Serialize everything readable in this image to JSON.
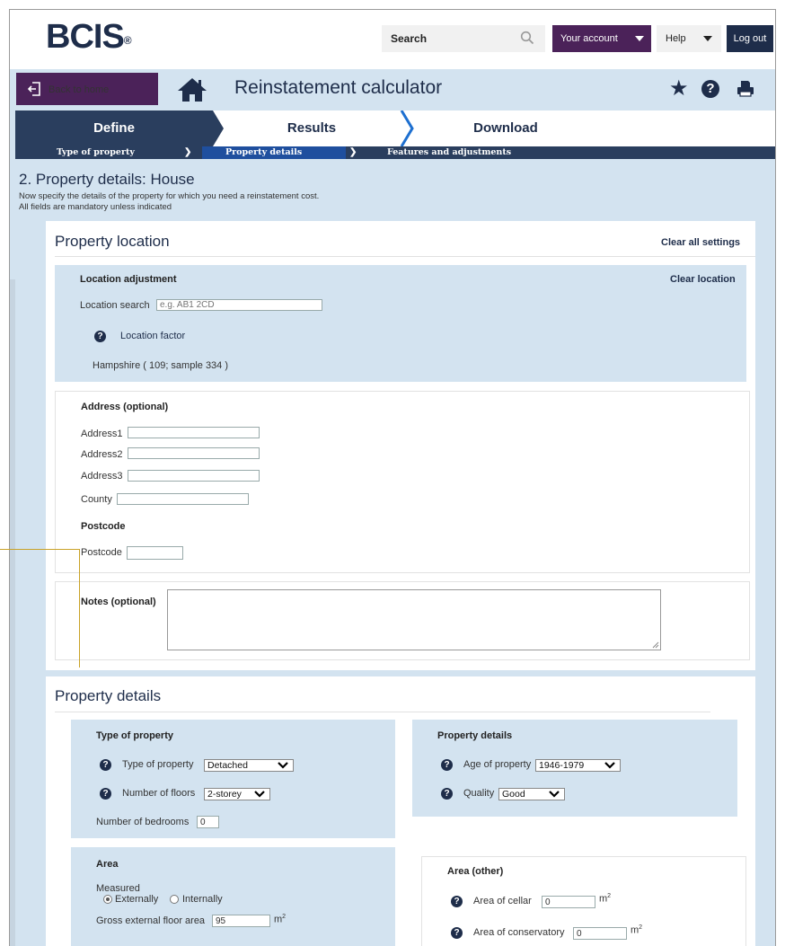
{
  "header": {
    "logo": "BCIS",
    "logo_reg": "®",
    "search_label": "Search",
    "account_label": "Your account",
    "help_label": "Help",
    "logout_label": "Log out"
  },
  "titlebar": {
    "back_label": "Back to home",
    "title": "Reinstatement calculator"
  },
  "steps": [
    {
      "label": "Define"
    },
    {
      "label": "Results"
    },
    {
      "label": "Download"
    }
  ],
  "substeps": [
    {
      "label": "Type of property"
    },
    {
      "label": "Property details"
    },
    {
      "label": "Features and adjustments"
    }
  ],
  "page": {
    "heading": "2. Property details: House",
    "intro1": "Now specify the details of the property for which you need a reinstatement cost.",
    "intro2": "All fields are mandatory unless indicated"
  },
  "location": {
    "title": "Property location",
    "clear_all": "Clear all settings",
    "adj_title": "Location adjustment",
    "clear_location": "Clear location",
    "search_label": "Location search",
    "search_placeholder": "e.g. AB1 2CD",
    "factor_label": "Location factor",
    "factor_value": "Hampshire ( 109; sample 334 )"
  },
  "address": {
    "title": "Address (optional)",
    "address1": "Address1",
    "address2": "Address2",
    "address3": "Address3",
    "county": "County",
    "postcode_title": "Postcode",
    "postcode": "Postcode"
  },
  "notes": {
    "label": "Notes (optional)"
  },
  "details": {
    "title": "Property details",
    "type_box": {
      "title": "Type of property",
      "type_label": "Type of property",
      "type_value": "Detached",
      "floors_label": "Number of floors",
      "floors_value": "2-storey",
      "bedrooms_label": "Number of bedrooms",
      "bedrooms_value": "0"
    },
    "details_box": {
      "title": "Property details",
      "age_label": "Age of property",
      "age_value": "1946-1979",
      "quality_label": "Quality",
      "quality_value": "Good"
    },
    "area_box": {
      "title": "Area",
      "measured_label": "Measured",
      "externally": "Externally",
      "internally": "Internally",
      "measured_selected": "Externally",
      "gefa_label": "Gross external floor area",
      "gefa_value": "95",
      "unit": "m",
      "unit_sup": "2"
    },
    "area_other_box": {
      "title": "Area (other)",
      "cellar_label": "Area of cellar",
      "cellar_value": "0",
      "conservatory_label": "Area of conservatory",
      "conservatory_value": "0",
      "unit": "m",
      "unit_sup": "2"
    }
  },
  "colors": {
    "navy": "#1e2d4a",
    "purple": "#4b2259",
    "light_blue": "#d3e3f0",
    "callout": "#c9a227"
  }
}
